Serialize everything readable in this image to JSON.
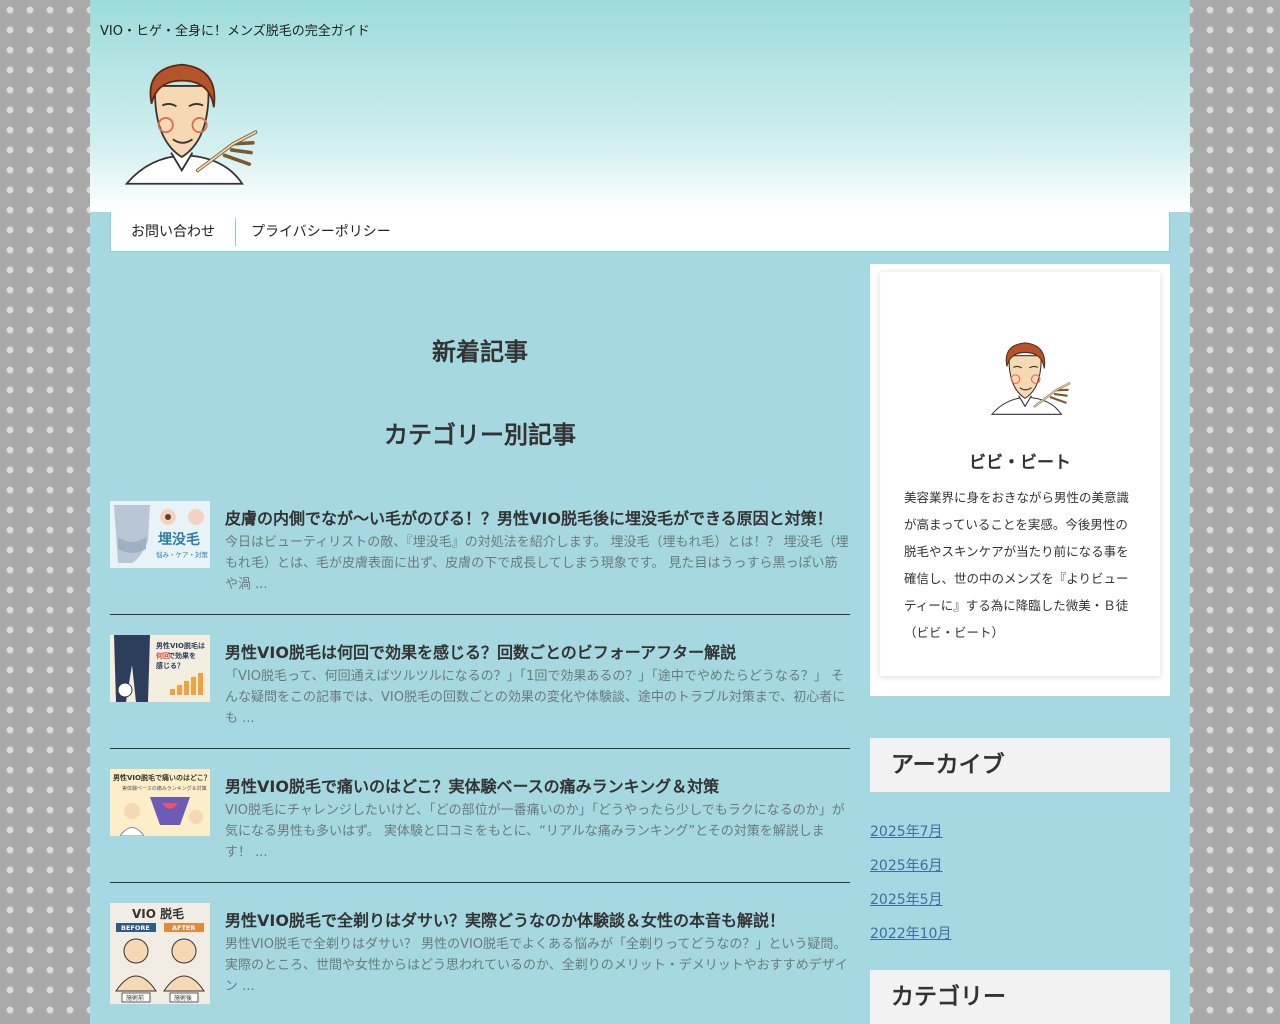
{
  "header": {
    "site_description": "VIO・ヒゲ・全身に！メンズ脱毛の完全ガイド"
  },
  "nav": {
    "items": [
      {
        "label": "お問い合わせ"
      },
      {
        "label": "プライバシーポリシー"
      }
    ]
  },
  "main": {
    "heading_new": "新着記事",
    "heading_category": "カテゴリー別記事",
    "posts": [
      {
        "title": "皮膚の内側でなが～い毛がのびる！？男性VIO脱毛後に埋没毛ができる原因と対策！",
        "excerpt": "今日はビューティリストの敵、『埋没毛』の対処法を紹介します。 埋没毛（埋もれ毛）とは！？ 埋没毛（埋もれ毛）とは、毛が皮膚表面に出ず、皮膚の下で成長してしまう現象です。 見た目はうっすら黒っぽい筋や渦 ...",
        "thumb_text": "埋没毛",
        "thumb_sub": "悩み・ケア・対策"
      },
      {
        "title": "男性VIO脱毛は何回で効果を感じる？回数ごとのビフォーアフター解説",
        "excerpt": "「VIO脱毛って、何回通えばツルツルになるの？」「1回で効果あるの？」「途中でやめたらどうなる？」 そんな疑問をこの記事では、VIO脱毛の回数ごとの効果の変化や体験談、途中のトラブル対策まで、初心者にも ...",
        "thumb_text_1": "男性VIO脱毛は",
        "thumb_text_2": "何回",
        "thumb_text_3": "で効果を",
        "thumb_text_4": "感じる？"
      },
      {
        "title": "男性VIO脱毛で痛いのはどこ？実体験ベースの痛みランキング＆対策",
        "excerpt": "VIO脱毛にチャレンジしたいけど、「どの部位が一番痛いのか」「どうやったら少しでもラクになるのか」が気になる男性も多いはず。 実体験と口コミをもとに、“リアルな痛みランキング”とその対策を解説します！ ...",
        "thumb_text": "男性VIO脱毛で痛いのはどこ？",
        "thumb_sub": "実体験ベースの痛みランキング＆対策"
      },
      {
        "title": "男性VIO脱毛で全剃りはダサい？実際どうなのか体験談＆女性の本音も解説！",
        "excerpt": "男性VIO脱毛で全剃りはダサい？ 男性のVIO脱毛でよくある悩みが「全剃りってどうなの？」という疑問。 実際のところ、世間や女性からはどう思われているのか、全剃りのメリット・デメリットやおすすめデザイン ...",
        "thumb_text": "VIO 脱毛",
        "thumb_before": "BEFORE",
        "thumb_after": "AFTER",
        "thumb_pre": "施術前",
        "thumb_post": "施術後"
      }
    ]
  },
  "sidebar": {
    "profile_name": "ビビ・ビート",
    "profile_text": "美容業界に身をおきながら男性の美意識が高まっていることを実感。今後男性の脱毛やスキンケアが当たり前になる事を確信し、世の中のメンズを『よりビューティーに』する為に降臨した微美・Ｂ徒（ビビ・ビート）",
    "archive_heading": "アーカイブ",
    "archives": [
      {
        "label": "2025年7月"
      },
      {
        "label": "2025年6月"
      },
      {
        "label": "2025年5月"
      },
      {
        "label": "2022年10月"
      }
    ],
    "category_heading": "カテゴリー"
  }
}
